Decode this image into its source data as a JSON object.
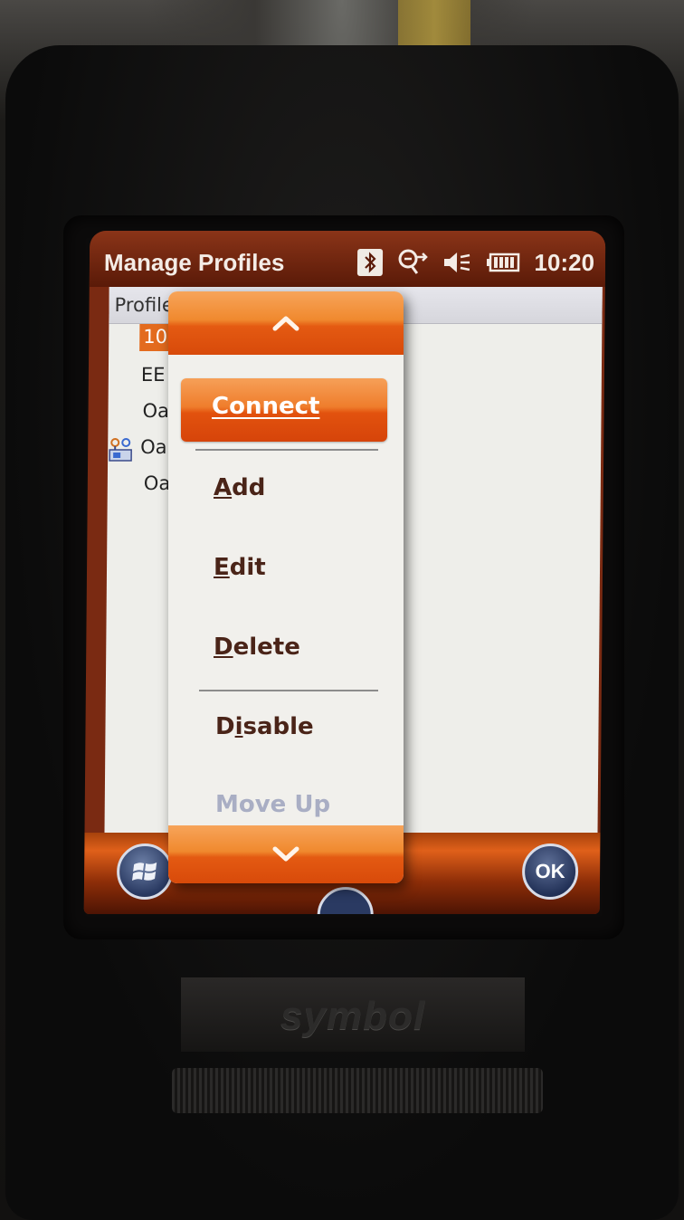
{
  "window": {
    "title": "Manage Profiles",
    "clock": "10:20"
  },
  "status_icons": [
    "bluetooth-icon",
    "connectivity-icon",
    "speaker-muted-icon",
    "battery-icon"
  ],
  "list": {
    "column_header": "Profile",
    "rows": [
      {
        "text": "101",
        "selected": true
      },
      {
        "text": "EE",
        "selected": false
      },
      {
        "text": "Oal",
        "selected": false
      },
      {
        "text": "Oal",
        "selected": false,
        "icon": "network-profile-icon"
      },
      {
        "text": "Oal",
        "selected": false
      }
    ]
  },
  "context_menu": {
    "items": [
      {
        "label": "Connect",
        "mnemonic": "C",
        "highlighted": true,
        "enabled": true
      },
      {
        "label": "Add",
        "mnemonic": "A",
        "highlighted": false,
        "enabled": true
      },
      {
        "label": "Edit",
        "mnemonic": "E",
        "highlighted": false,
        "enabled": true
      },
      {
        "label": "Delete",
        "mnemonic": "D",
        "highlighted": false,
        "enabled": true
      },
      {
        "label": "Disable",
        "mnemonic": "i",
        "highlighted": false,
        "enabled": true
      },
      {
        "label": "Move Up",
        "mnemonic": "",
        "highlighted": false,
        "enabled": false
      }
    ]
  },
  "taskbar": {
    "start_icon": "windows-start-icon",
    "ok_label": "OK"
  },
  "device": {
    "brand": "symbol"
  },
  "colors": {
    "accent_orange": "#e8601a",
    "titlebar": "#6a2210",
    "menu_text": "#4a2418",
    "disabled_text": "#a9aec4"
  }
}
